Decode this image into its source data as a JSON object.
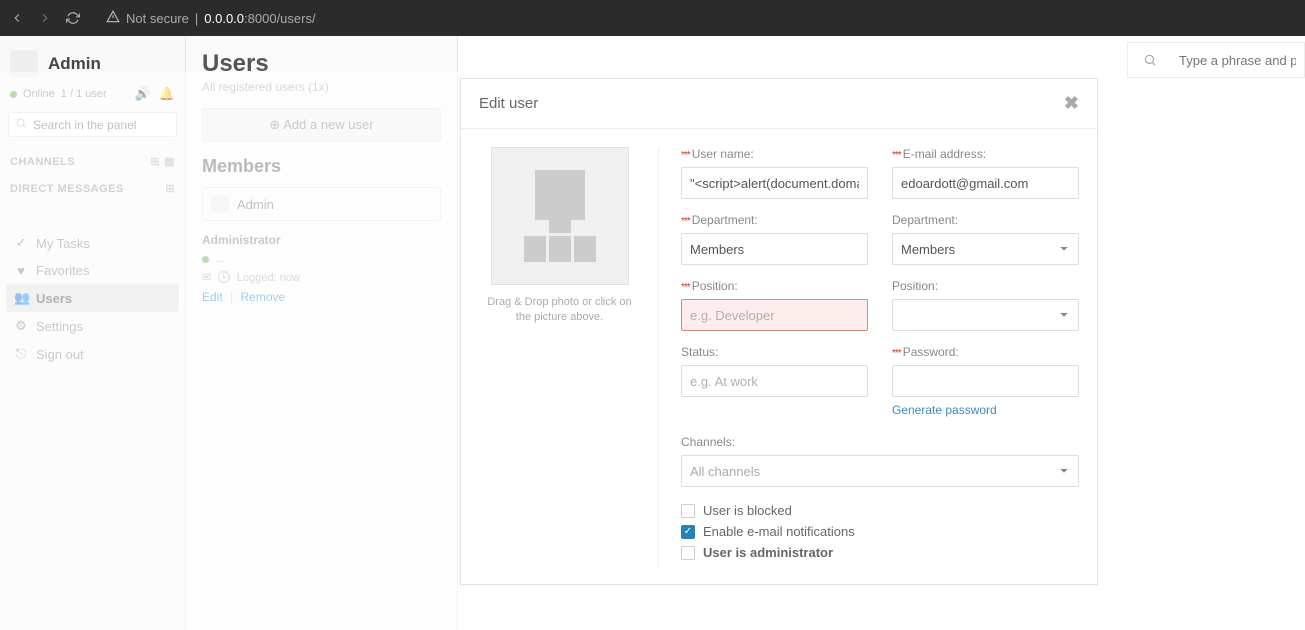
{
  "browser": {
    "not_secure_label": "Not secure",
    "url_host": "0.0.0.0",
    "url_rest": ":8000/users/"
  },
  "sidebar": {
    "username": "Admin",
    "status_text": "Online",
    "status_count": "1 / 1 user",
    "search_placeholder": "Search in the panel",
    "section_channels": "CHANNELS",
    "section_dm": "DIRECT MESSAGES",
    "nav": {
      "tasks": "My Tasks",
      "favorites": "Favorites",
      "users": "Users",
      "settings": "Settings",
      "signout": "Sign out"
    }
  },
  "mid": {
    "title": "Users",
    "subtitle": "All registered users (1x)",
    "add_user": "Add a new user",
    "members_header": "Members",
    "member_name": "Admin",
    "admin_label": "Administrator",
    "status_dots": "...",
    "logged_label": "Logged: now",
    "edit": "Edit",
    "remove": "Remove"
  },
  "top_search": {
    "placeholder": "Type a phrase and pre"
  },
  "modal": {
    "title": "Edit user",
    "photo_hint": "Drag & Drop photo or click on the picture above.",
    "labels": {
      "username": "User name:",
      "email": "E-mail address:",
      "department": "Department:",
      "department_select": "Department:",
      "position": "Position:",
      "position_select": "Position:",
      "status": "Status:",
      "password": "Password:",
      "channels": "Channels:"
    },
    "values": {
      "username": "\"<script>alert(document.doma",
      "email": "edoardott@gmail.com",
      "department": "Members",
      "department_select": "Members",
      "position": "",
      "position_select": "",
      "status": "",
      "password": "",
      "channels": "All channels"
    },
    "placeholders": {
      "position": "e.g. Developer",
      "status": "e.g. At work"
    },
    "generate_password": "Generate password",
    "checks": {
      "blocked": "User is blocked",
      "email_notif": "Enable e-mail notifications",
      "is_admin": "User is administrator"
    }
  }
}
